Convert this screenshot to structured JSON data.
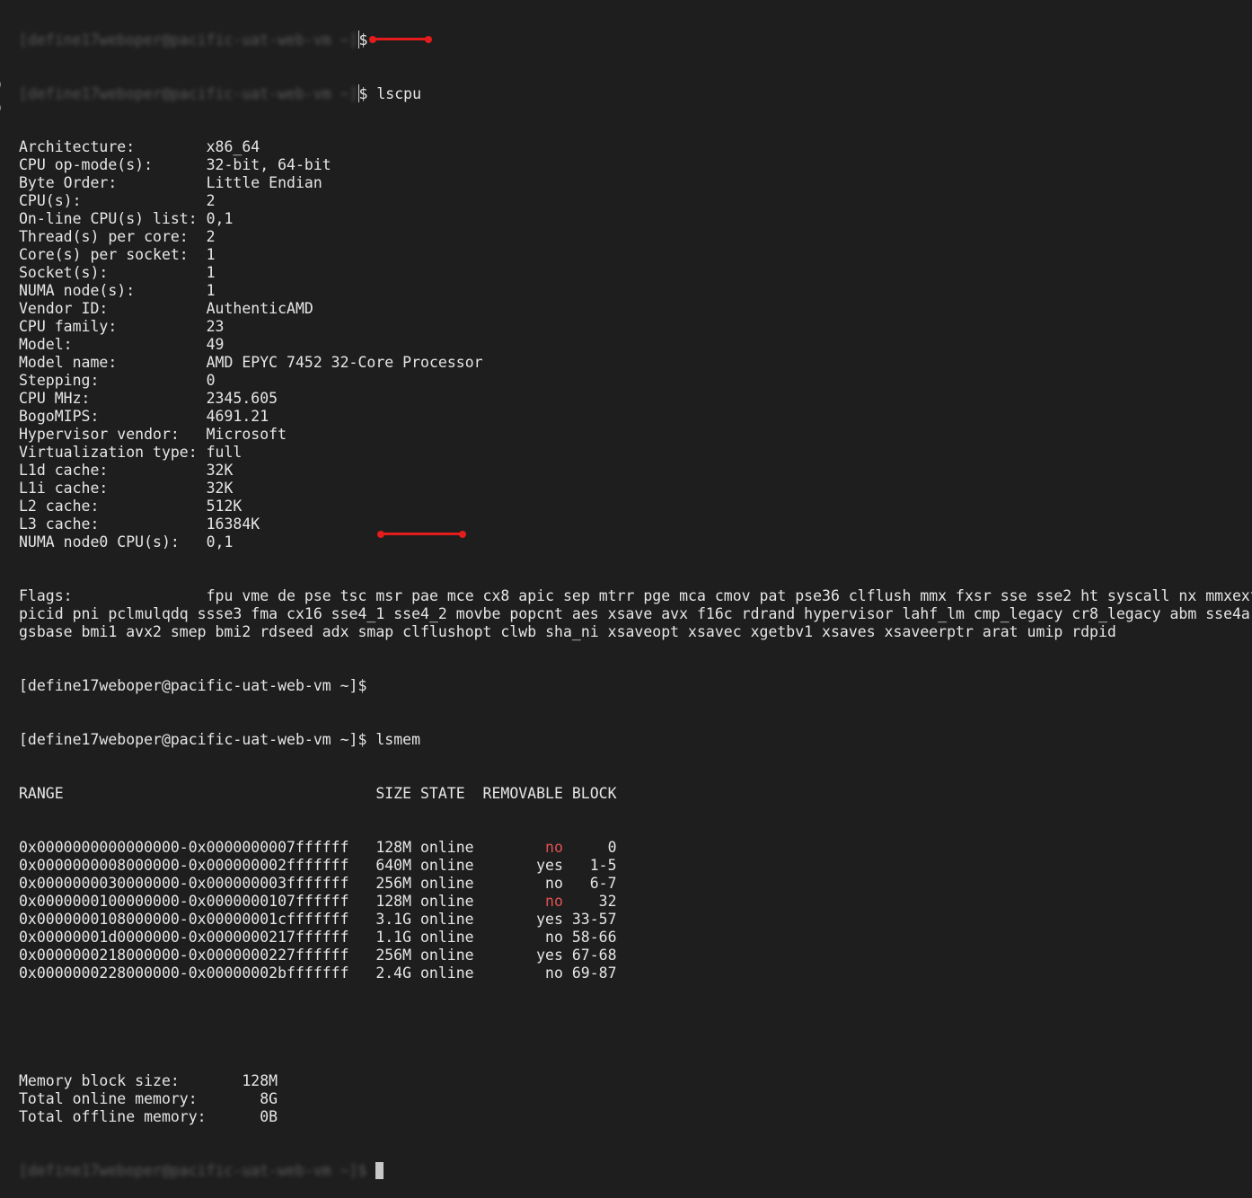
{
  "terminal": {
    "prompt": "[define17weboper@pacific-uat-web-vm ~]$",
    "blurred_prompt": "[define17weboper@pacific-uat-web-vm ~]",
    "cmd_lscpu": "lscpu",
    "cmd_lsmem": "lsmem",
    "left_edge_glyph": ")"
  },
  "lscpu": [
    {
      "key": "Architecture:",
      "value": "x86_64"
    },
    {
      "key": "CPU op-mode(s):",
      "value": "32-bit, 64-bit"
    },
    {
      "key": "Byte Order:",
      "value": "Little Endian"
    },
    {
      "key": "CPU(s):",
      "value": "2"
    },
    {
      "key": "On-line CPU(s) list:",
      "value": "0,1"
    },
    {
      "key": "Thread(s) per core:",
      "value": "2"
    },
    {
      "key": "Core(s) per socket:",
      "value": "1"
    },
    {
      "key": "Socket(s):",
      "value": "1"
    },
    {
      "key": "NUMA node(s):",
      "value": "1"
    },
    {
      "key": "Vendor ID:",
      "value": "AuthenticAMD"
    },
    {
      "key": "CPU family:",
      "value": "23"
    },
    {
      "key": "Model:",
      "value": "49"
    },
    {
      "key": "Model name:",
      "value": "AMD EPYC 7452 32-Core Processor"
    },
    {
      "key": "Stepping:",
      "value": "0"
    },
    {
      "key": "CPU MHz:",
      "value": "2345.605"
    },
    {
      "key": "BogoMIPS:",
      "value": "4691.21"
    },
    {
      "key": "Hypervisor vendor:",
      "value": "Microsoft"
    },
    {
      "key": "Virtualization type:",
      "value": "full"
    },
    {
      "key": "L1d cache:",
      "value": "32K"
    },
    {
      "key": "L1i cache:",
      "value": "32K"
    },
    {
      "key": "L2 cache:",
      "value": "512K"
    },
    {
      "key": "L3 cache:",
      "value": "16384K"
    },
    {
      "key": "NUMA node0 CPU(s):",
      "value": "0,1"
    }
  ],
  "flags": {
    "key": "Flags:",
    "lines": [
      "fpu vme de pse tsc msr pae mce cx8 apic sep mtrr pge mca cmov pat pse36 clflush mmx fxsr sse sse2 ht syscall nx mmxext",
      "picid pni pclmulqdq ssse3 fma cx16 sse4_1 sse4_2 movbe popcnt aes xsave avx f16c rdrand hypervisor lahf_lm cmp_legacy cr8_legacy abm sse4a",
      "gsbase bmi1 avx2 smep bmi2 rdseed adx smap clflushopt clwb sha_ni xsaveopt xsavec xgetbv1 xsaves xsaveerptr arat umip rdpid"
    ]
  },
  "lsmem": {
    "headers": {
      "range": "RANGE",
      "size": "SIZE",
      "state": "STATE",
      "removable": "REMOVABLE",
      "block": "BLOCK"
    },
    "rows": [
      {
        "range": "0x0000000000000000-0x0000000007ffffff",
        "size": "128M",
        "state": "online",
        "removable": "no",
        "block": "0",
        "highlight": true
      },
      {
        "range": "0x0000000008000000-0x000000002fffffff",
        "size": "640M",
        "state": "online",
        "removable": "yes",
        "block": "1-5",
        "highlight": false
      },
      {
        "range": "0x0000000030000000-0x000000003fffffff",
        "size": "256M",
        "state": "online",
        "removable": "no",
        "block": "6-7",
        "highlight": false
      },
      {
        "range": "0x0000000100000000-0x0000000107ffffff",
        "size": "128M",
        "state": "online",
        "removable": "no",
        "block": "32",
        "highlight": true
      },
      {
        "range": "0x0000000108000000-0x00000001cfffffff",
        "size": "3.1G",
        "state": "online",
        "removable": "yes",
        "block": "33-57",
        "highlight": false
      },
      {
        "range": "0x00000001d0000000-0x0000000217ffffff",
        "size": "1.1G",
        "state": "online",
        "removable": "no",
        "block": "58-66",
        "highlight": false
      },
      {
        "range": "0x0000000218000000-0x0000000227ffffff",
        "size": "256M",
        "state": "online",
        "removable": "yes",
        "block": "67-68",
        "highlight": false
      },
      {
        "range": "0x0000000228000000-0x00000002bfffffff",
        "size": "2.4G",
        "state": "online",
        "removable": "no",
        "block": "69-87",
        "highlight": false
      }
    ],
    "summary": [
      {
        "key": "Memory block size:",
        "value": "128M"
      },
      {
        "key": "Total online memory:",
        "value": "8G"
      },
      {
        "key": "Total offline memory:",
        "value": "0B"
      }
    ]
  },
  "colors": {
    "background": "#1e1e1e",
    "text": "#e6e6e6",
    "highlight": "#e05252",
    "annotation": "#e41c1c"
  }
}
